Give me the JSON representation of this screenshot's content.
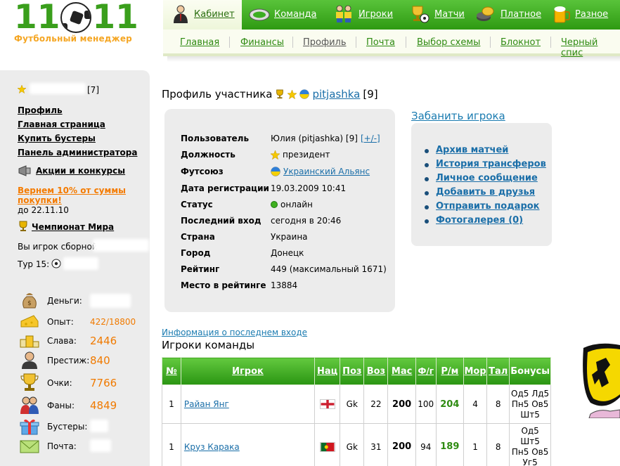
{
  "logo": {
    "number_left": "11",
    "number_right": "11",
    "subtitle": "Футбольный менеджер"
  },
  "nav": {
    "items": [
      {
        "label": "Кабинет",
        "icon": "manager-icon"
      },
      {
        "label": "Команда",
        "icon": "stadium-icon"
      },
      {
        "label": "Игроки",
        "icon": "players-icon"
      },
      {
        "label": "Матчи",
        "icon": "trophy-ball-icon"
      },
      {
        "label": "Платное",
        "icon": "coins-icon"
      },
      {
        "label": "Разное",
        "icon": "beer-icon"
      }
    ],
    "sub_items": [
      "Главная",
      "Финансы",
      "Профиль",
      "Почта",
      "Выбор схемы",
      "Блокнот",
      "Черный спис"
    ]
  },
  "sidebar": {
    "user_level": "[7]",
    "links": [
      "Профиль",
      "Главная страница",
      "Купить бустеры",
      "Панель администратора"
    ],
    "actions_link": "Акции и конкурсы",
    "promo_text": "Вернем 10% от суммы покупки!",
    "promo_date": "до 22.11.10",
    "world_cup_link": "Чемпионат Мира",
    "national_team_text": "Вы игрок сборной",
    "tour_text": "Тур 15:",
    "stats": [
      {
        "label": "Деньги:",
        "value": "",
        "icon": "money-bag-icon"
      },
      {
        "label": "Опыт:",
        "value": "422/18800",
        "icon": "cheese-icon"
      },
      {
        "label": "Слава:",
        "value": "2446",
        "icon": "podium-icon"
      },
      {
        "label": "Престиж:",
        "value": "840",
        "icon": "person-icon"
      },
      {
        "label": "Очки:",
        "value": "7766",
        "icon": "cup-icon"
      },
      {
        "label": "Фаны:",
        "value": "4849",
        "icon": "fans-icon"
      },
      {
        "label": "Бустеры:",
        "value": "",
        "icon": "gift-icon"
      },
      {
        "label": "Почта:",
        "value": "",
        "icon": "envelope-icon"
      }
    ]
  },
  "profile": {
    "title": "Профиль участника",
    "nick": "pitjashka",
    "level": "[9]",
    "rows": [
      {
        "label": "Пользователь",
        "value": "Юлия (pitjashka) [9]",
        "extra_link": "[+/-]"
      },
      {
        "label": "Должность",
        "value": "президент"
      },
      {
        "label": "Футсоюз",
        "value": "Украинский Альянс"
      },
      {
        "label": "Дата регистрации",
        "value": "19.03.2009 10:41"
      },
      {
        "label": "Статус",
        "value": "онлайн"
      },
      {
        "label": "Последний вход",
        "value": "сегодня в 20:46"
      },
      {
        "label": "Страна",
        "value": "Украина"
      },
      {
        "label": "Город",
        "value": "Донецк"
      },
      {
        "label": "Рейтинг",
        "value": "449 (максимальный 1671)"
      },
      {
        "label": "Место в рейтинге",
        "value": "13884"
      }
    ],
    "ban_link": "Забанить игрока",
    "actions": [
      "Архив матчей",
      "История трансферов",
      "Личное сообщение",
      "Добавить в друзья",
      "Отправить подарок",
      "Фотогалерея (0)"
    ],
    "last_login_link": "Информация о последнем входе"
  },
  "team": {
    "title": "Игроки команды",
    "columns": [
      "№",
      "Игрок",
      "Нац",
      "Поз",
      "Воз",
      "Мас",
      "Ф/г",
      "Р/м",
      "Мор",
      "Тал",
      "Бонусы"
    ],
    "rows": [
      {
        "num": "1",
        "name": "Райан Янг",
        "nat": "england",
        "pos": "Gk",
        "age": "22",
        "mas": "200",
        "fg": "100",
        "rm": "204",
        "mor": "4",
        "tal": "8",
        "bonus": [
          "Од5 Лд5",
          "Пн5 Ов5",
          "Шт5"
        ]
      },
      {
        "num": "1",
        "name": "Круз Карака",
        "nat": "portugal",
        "pos": "Gk",
        "age": "31",
        "mas": "200",
        "fg": "94",
        "rm": "189",
        "mor": "1",
        "tal": "8",
        "bonus": [
          "Од5",
          "Шт5",
          "Пн5 Ов5",
          "Уг5"
        ]
      }
    ]
  }
}
